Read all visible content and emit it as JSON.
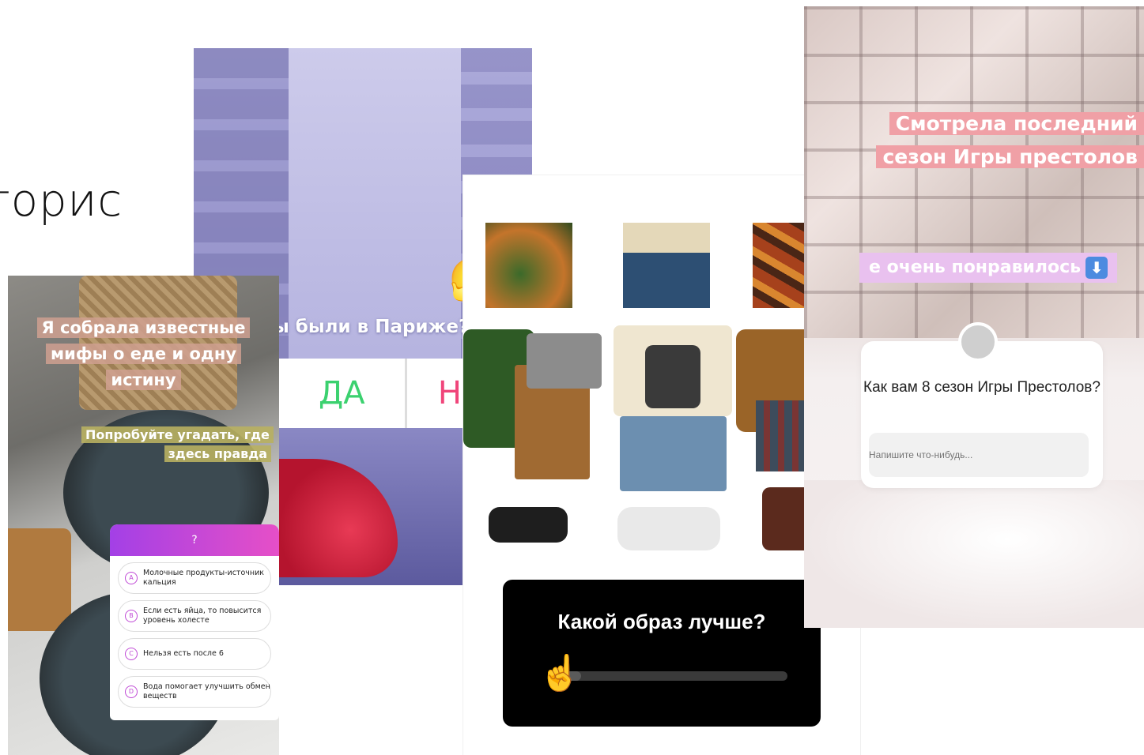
{
  "heading": "торис",
  "paris": {
    "question": "ы были в Париже?",
    "option_yes": "ДА",
    "option_no": "НЕТ"
  },
  "food": {
    "caption": "Я собрала известные мифы о еде и одну истину",
    "hint": "Попробуйте угадать, где здесь правда",
    "quiz_title": "?",
    "options": [
      {
        "letter": "A",
        "text": "Молочные продукты-источник кальция"
      },
      {
        "letter": "B",
        "text": "Если есть яйца, то повысится уровень холесте"
      },
      {
        "letter": "C",
        "text": "Нельзя есть после 6"
      },
      {
        "letter": "D",
        "text": "Вода помогает улучшить обмен веществ"
      }
    ]
  },
  "outfit": {
    "question": "Какой образ лучше?",
    "slider_value": 0.1
  },
  "got": {
    "caption_main_line1": "Смотрела последний",
    "caption_main_line2": "сезон Игры престолов",
    "caption_sub": "е очень понравилось",
    "question": "Как вам 8 сезон Игры Престолов?",
    "input_placeholder": "Напишите что-нибудь...",
    "sub_icon": "down-arrow-icon"
  }
}
